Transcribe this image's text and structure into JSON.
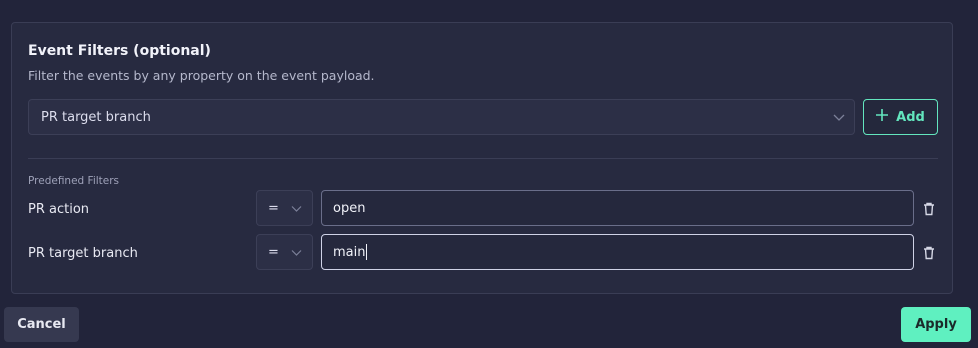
{
  "panel": {
    "title": "Event Filters (optional)",
    "subtitle": "Filter the events by any property on the event payload.",
    "filter_select": {
      "value": "PR target branch",
      "icon": "chevron-down-icon"
    },
    "add_button": {
      "label": "Add",
      "icon": "plus-icon"
    },
    "section_label": "Predefined Filters",
    "filters": [
      {
        "label": "PR action",
        "operator": "=",
        "value": "open",
        "focused": false
      },
      {
        "label": "PR target branch",
        "operator": "=",
        "value": "main",
        "focused": true
      }
    ]
  },
  "footer": {
    "cancel_label": "Cancel",
    "apply_label": "Apply"
  },
  "colors": {
    "background": "#22243a",
    "panel": "#272a40",
    "accent": "#63e6be",
    "apply_bg": "#5ff0c0"
  }
}
